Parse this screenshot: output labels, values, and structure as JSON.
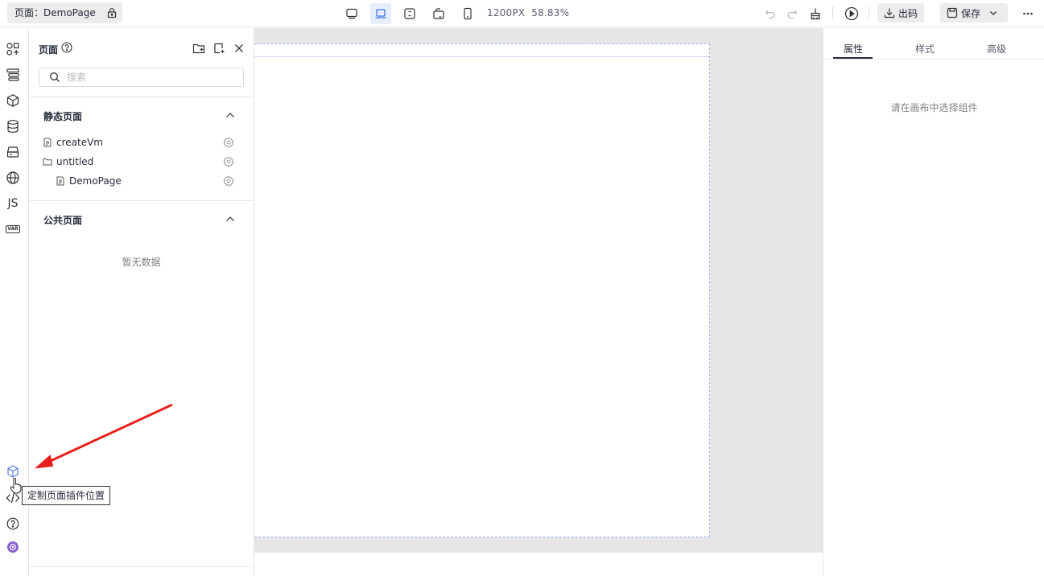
{
  "topbar": {
    "page_label": "页面：DemoPage",
    "canvas_width": "1200PX",
    "canvas_zoom": "58.83%",
    "export_label": "出码",
    "save_label": "保存",
    "device_icons": [
      "desktop-icon",
      "laptop-icon",
      "tablet-landscape-icon",
      "tablet-rotate-icon",
      "mobile-icon"
    ],
    "active_device": "laptop-icon"
  },
  "leftbar": {
    "icons": [
      "components-icon",
      "outline-icon",
      "blocks-icon",
      "datasource-icon",
      "bridge-icon",
      "i18n-icon",
      "js-icon",
      "var-icon"
    ],
    "js_label": "JS",
    "var_label": "VAR",
    "bottom_icons": [
      "page-plugin-icon",
      "code-icon",
      "help-icon",
      "ai-robot-icon"
    ]
  },
  "page_panel": {
    "title": "页面",
    "search_placeholder": "搜索",
    "static_section": {
      "title": "静态页面",
      "items": [
        {
          "label": "createVm",
          "type": "page",
          "indent": 0
        },
        {
          "label": "untitled",
          "type": "folder",
          "indent": 0
        },
        {
          "label": "DemoPage",
          "type": "page",
          "indent": 1
        }
      ]
    },
    "public_section": {
      "title": "公共页面",
      "empty_text": "暂无数据"
    }
  },
  "right_panel": {
    "tabs": [
      {
        "label": "属性",
        "active": true
      },
      {
        "label": "样式",
        "active": false
      },
      {
        "label": "高级",
        "active": false
      }
    ],
    "empty_text": "请在画布中选择组件"
  },
  "tooltip": {
    "text": "定制页面插件位置"
  },
  "colors": {
    "accent": "#5e7ce0",
    "annotation_arrow": "#e8201c",
    "canvas_bg": "#e6e6e6"
  }
}
